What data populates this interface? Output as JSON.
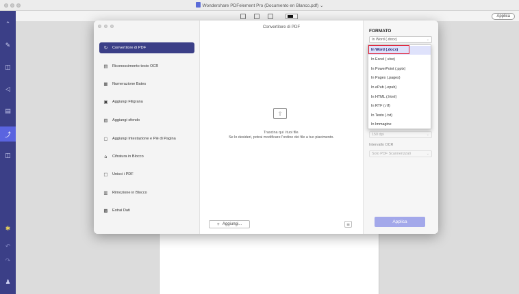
{
  "window": {
    "title": "Wondershare PDFelement Pro (Documento en Blanco.pdf) ⌄"
  },
  "toolbar": {
    "apply_label": "Applica"
  },
  "sidebar": {
    "icons": [
      "chevron-up-icon",
      "pencil-icon",
      "comment-icon",
      "send-icon",
      "form-icon",
      "convert-icon",
      "chat-icon",
      "app-logo-icon",
      "undo-icon",
      "redo-icon",
      "user-icon"
    ]
  },
  "dialog": {
    "title": "Convertitore di PDF",
    "nav": [
      {
        "label": "Convertitore di PDF",
        "icon": "↻"
      },
      {
        "label": "Riconoscimento testo OCR",
        "icon": "▤"
      },
      {
        "label": "Numerazione Bates",
        "icon": "▦"
      },
      {
        "label": "Aggiungi Filigrana",
        "icon": "▣"
      },
      {
        "label": "Aggiungi sfondo",
        "icon": "▧"
      },
      {
        "label": "Aggiungi Intestazione e Piè di Pagina",
        "icon": "▢"
      },
      {
        "label": "Cifratura in Blocco",
        "icon": "⌂"
      },
      {
        "label": "Unisci i PDF",
        "icon": "□"
      },
      {
        "label": "Rimozione in Blocco",
        "icon": "▥"
      },
      {
        "label": "Estrai Dati",
        "icon": "▩"
      }
    ],
    "drop_text_1": "Trascina qui i tuoi file.",
    "drop_text_2": "Se lo desideri, potrai modificare l'ordine dei file a tuo piacimento.",
    "add_label": "Aggiungi...",
    "format_label": "FORMATO",
    "format_value": "In Word (.docx)",
    "dpi_value": "150 dpi",
    "ocr_label": "Intervallo OCR",
    "ocr_value": "Solo PDF Scannerizzati",
    "apply_label": "Applica"
  },
  "dropdown": {
    "options": [
      "In Word (.docx)",
      "In Excel (.xlsx)",
      "In PowerPoint (.pptx)",
      "In Pages (.pages)",
      "In ePub (.epub)",
      "In HTML (.html)",
      "In RTF (.rtf)",
      "In Testo (.txt)",
      "In Immagine"
    ],
    "selected_index": 0
  },
  "colors": {
    "sidebar_bg": "#3b3f87",
    "sidebar_active": "#5a64e0",
    "nav_active_bg": "#3b3f87",
    "apply_button": "#a3a8ea",
    "highlight": "#e0233a"
  }
}
